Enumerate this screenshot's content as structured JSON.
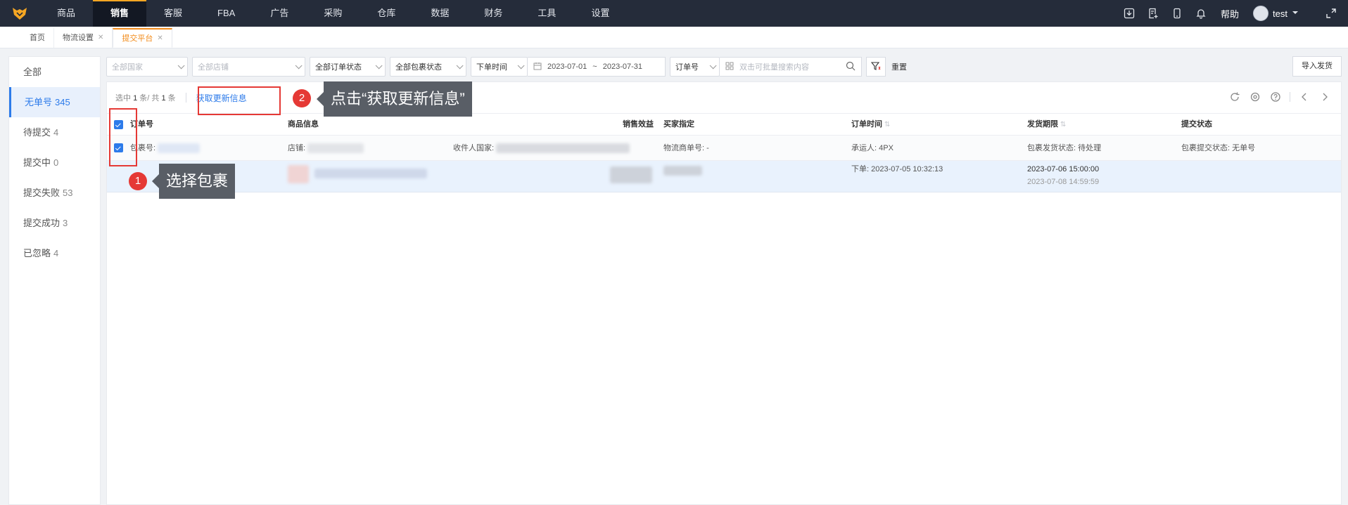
{
  "topnav": {
    "items": [
      "商品",
      "销售",
      "客服",
      "FBA",
      "广告",
      "采购",
      "仓库",
      "数据",
      "财务",
      "工具",
      "设置"
    ],
    "active_index": 1,
    "help": "帮助",
    "username": "test"
  },
  "page_tabs": [
    {
      "label": "首页",
      "closable": false
    },
    {
      "label": "物流设置",
      "closable": true
    },
    {
      "label": "提交平台",
      "closable": true,
      "active": true
    }
  ],
  "status_list": [
    {
      "label": "全部",
      "count": ""
    },
    {
      "label": "无单号",
      "count": "345",
      "active": true
    },
    {
      "label": "待提交",
      "count": "4"
    },
    {
      "label": "提交中",
      "count": "0"
    },
    {
      "label": "提交失败",
      "count": "53"
    },
    {
      "label": "提交成功",
      "count": "3"
    },
    {
      "label": "已忽略",
      "count": "4"
    }
  ],
  "filters": {
    "country": "全部国家",
    "store": "全部店铺",
    "order_status": "全部订单状态",
    "package_status": "全部包裹状态",
    "time_type": "下单时间",
    "date_start": "2023-07-01",
    "date_sep": "~",
    "date_end": "2023-07-31",
    "search_type": "订单号",
    "search_placeholder": "双击可批量搜索内容",
    "reset": "重置",
    "import_btn": "导入发货"
  },
  "toolbar": {
    "selected_label": "选中",
    "selected_count": "1",
    "unit_total": "条/ 共",
    "total_count": "1",
    "unit": "条",
    "fetch_link": "获取更新信息"
  },
  "table": {
    "headers": {
      "order_no": "订单号",
      "product": "商品信息",
      "profit": "销售效益",
      "buyer": "买家指定",
      "order_time": "订单时间",
      "ship_deadline": "发货期限",
      "submit_status": "提交状态"
    },
    "package_row": {
      "package_no_label": "包裹号:",
      "store_label": "店铺:",
      "country_label": "收件人国家:",
      "tracking_label": "物流商单号: -",
      "carrier": "承运人:  4PX",
      "ship_status": "包裹发货状态:  待处理",
      "submit_status": "包裹提交状态:  无单号"
    },
    "order_row": {
      "order_time": "下单:  2023-07-05 10:32:13",
      "deadline_1": "2023-07-06 15:00:00",
      "deadline_2": "2023-07-08 14:59:59"
    }
  },
  "annotations": {
    "step1_num": "1",
    "step1_text": "选择包裹",
    "step2_num": "2",
    "step2_text": "点击“获取更新信息”"
  },
  "colors": {
    "nav_bg": "#252c3a",
    "accent_orange": "#f28b1a",
    "link_blue": "#2d7bea",
    "annotation_red": "#e53935",
    "callout_gray": "#595e66"
  }
}
